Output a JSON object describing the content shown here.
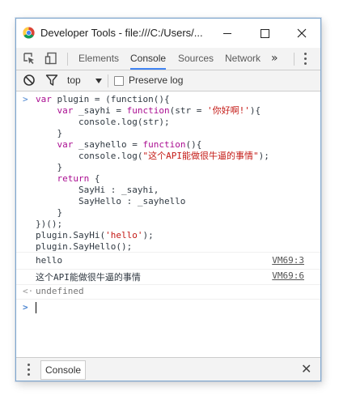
{
  "window": {
    "title": "Developer Tools - file:///C:/Users/...",
    "minimize_icon": "minimize-icon",
    "maximize_icon": "maximize-icon",
    "close_icon": "close-icon"
  },
  "tabs": {
    "items": [
      {
        "label": "Elements",
        "active": false
      },
      {
        "label": "Console",
        "active": true
      },
      {
        "label": "Sources",
        "active": false
      },
      {
        "label": "Network",
        "active": false
      }
    ],
    "more": "»"
  },
  "toolbar": {
    "context": "top",
    "preserve_log_label": "Preserve log",
    "preserve_log_checked": false
  },
  "console": {
    "code_lines": [
      "var plugin = (function(){",
      "    var _sayhi = function(str = '你好啊!'){",
      "        console.log(str);",
      "    }",
      "    var _sayhello = function(){",
      "        console.log(\"这个API能做很牛逼的事情\");",
      "    }",
      "    return {",
      "        SayHi : _sayhi,",
      "        SayHello : _sayhello",
      "    }",
      "})();",
      "plugin.SayHi('hello');",
      "plugin.SayHello();"
    ],
    "logs": [
      {
        "text": "hello",
        "source": "VM69:3"
      },
      {
        "text": "这个API能做很牛逼的事情",
        "source": "VM69:6"
      }
    ],
    "result": "undefined",
    "input_value": ""
  },
  "drawer": {
    "tab_label": "Console",
    "close_glyph": "✕"
  },
  "colors": {
    "keyword": "#aa0d91",
    "string": "#c41a16",
    "active_tab": "#4285f4",
    "prompt": "#4d86d1"
  }
}
